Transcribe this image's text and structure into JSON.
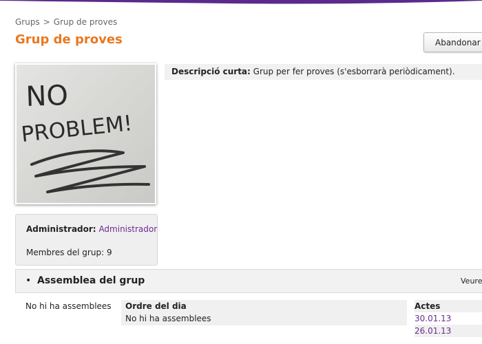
{
  "breadcrumb": {
    "items": [
      "Grups",
      "Grup de proves"
    ],
    "separator": ">"
  },
  "page": {
    "title": "Grup de proves"
  },
  "actions": {
    "leave_label": "Abandonar e"
  },
  "photo": {
    "lines": [
      "NO",
      "PROBLEM!"
    ]
  },
  "description": {
    "label": "Descripció curta:",
    "text": "Grup per fer proves (s'esborrarà periòdicament)."
  },
  "admin_box": {
    "admin_label": "Administrador:",
    "admin_name": "Administrador",
    "members_text": "Membres del grup: 9"
  },
  "assemblies": {
    "title": "Assemblea del grup",
    "bullet": "•",
    "see_link": "Veure",
    "empty_left": "No hi ha assemblees",
    "agenda_header": "Ordre del dia",
    "agenda_value": "No hi ha assemblees",
    "minutes_header": "Actes",
    "minutes": [
      "30.01.13",
      "26.01.13"
    ]
  },
  "colors": {
    "title": "#e8781f",
    "link": "#6a2a95",
    "top_band": "#5a2a8c"
  }
}
